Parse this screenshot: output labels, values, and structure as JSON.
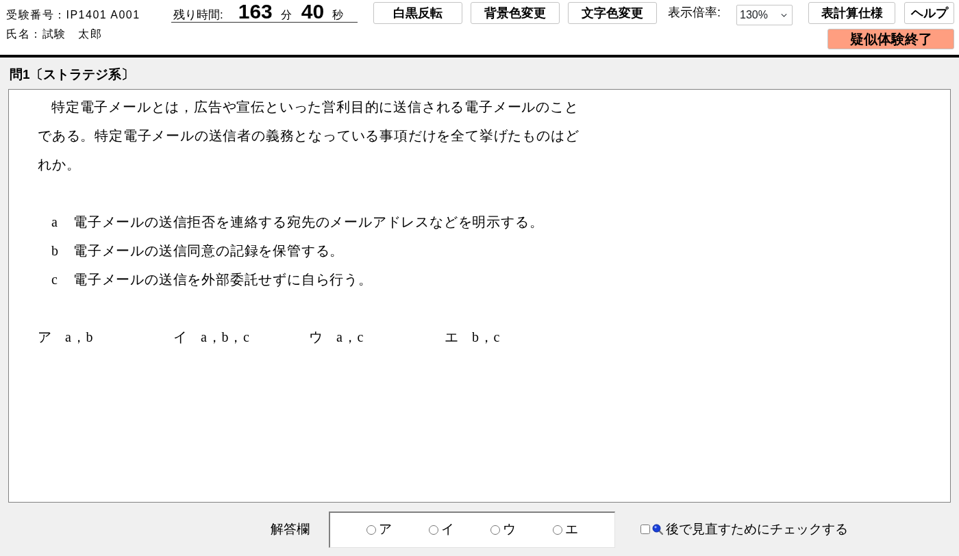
{
  "header": {
    "examinee_number": "受験番号：IP1401 A001",
    "examinee_name": "氏名：試験　太郎",
    "timer": {
      "label": "残り時間:",
      "minutes": "163",
      "minutes_unit": "分",
      "seconds": "40",
      "seconds_unit": "秒"
    },
    "display_buttons": [
      "白黒反転",
      "背景色変更",
      "文字色変更"
    ],
    "zoom": {
      "label": "表示倍率:",
      "value": "130%"
    },
    "help_buttons": [
      "表計算仕様",
      "ヘルプ"
    ],
    "exit_button": "疑似体験終了"
  },
  "question": {
    "title": "問1〔ストラテジ系〕",
    "stem": "特定電子メールとは，広告や宣伝といった営利目的に送信される電子メールのことである。特定電子メールの送信者の義務となっている事項だけを全て挙げたものはどれか。",
    "statements": [
      {
        "letter": "a",
        "text": "電子メールの送信拒否を連絡する宛先のメールアドレスなどを明示する。"
      },
      {
        "letter": "b",
        "text": "電子メールの送信同意の記録を保管する。"
      },
      {
        "letter": "c",
        "text": "電子メールの送信を外部委託せずに自ら行う。"
      }
    ],
    "choices": [
      {
        "label": "ア",
        "text": "a，b"
      },
      {
        "label": "イ",
        "text": "a，b，c"
      },
      {
        "label": "ウ",
        "text": "a，c"
      },
      {
        "label": "エ",
        "text": "b，c"
      }
    ]
  },
  "answer_area": {
    "label": "解答欄",
    "options": [
      {
        "label": "ア",
        "selected": false
      },
      {
        "label": "イ",
        "selected": false
      },
      {
        "label": "ウ",
        "selected": false
      },
      {
        "label": "エ",
        "selected": false
      }
    ]
  },
  "review_check": {
    "label": "後で見直すためにチェックする",
    "checked": false
  }
}
